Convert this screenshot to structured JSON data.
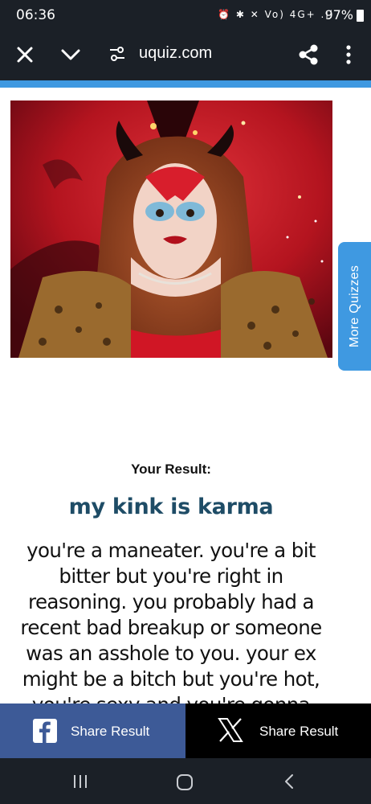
{
  "status_bar": {
    "time": "06:36",
    "indicators": "⏰ ✱ ✕ Vo) 4G+ .ıl",
    "battery": "97%"
  },
  "browser": {
    "url": "uquiz.com",
    "icons": {
      "close": "close-icon",
      "collapse": "chevron-down-icon",
      "site_settings": "tune-icon",
      "share": "share-icon",
      "menu": "more-vert-icon"
    }
  },
  "side_tab": {
    "label": "More Quizzes",
    "color": "#3f99e1"
  },
  "result": {
    "label": "Your Result:",
    "title": "my kink is karma",
    "description": "you're a maneater. you're a bit bitter but you're right in reasoning. you probably had a recent bad breakup or someone was an asshole to you. your ex might be a bitch but you're hot, you're sexy and you're gonna serve exactly what your ex is: CUNT."
  },
  "share": {
    "facebook_label": "Share Result",
    "x_label": "Share Result",
    "facebook_color": "#3d5a97",
    "x_color": "#000000"
  },
  "colors": {
    "accent": "#3f99e1",
    "title": "#1e4c66",
    "chrome": "#1b2027"
  }
}
